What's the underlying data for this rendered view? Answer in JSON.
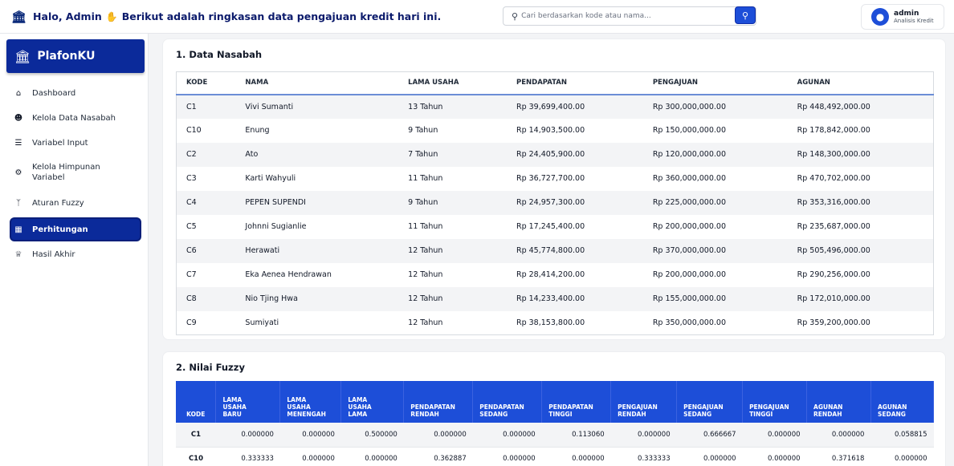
{
  "header": {
    "greeting_prefix": "Halo, Admin",
    "greeting_suffix": "Berikut adalah ringkasan data pengajuan kredit hari ini.",
    "search_placeholder": "Cari berdasarkan kode atau nama...",
    "user_name": "admin",
    "user_role": "Analisis Kredit"
  },
  "sidebar": {
    "brand": "PlafonKU",
    "items": [
      {
        "label": "Dashboard",
        "icon": "home-icon"
      },
      {
        "label": "Kelola Data Nasabah",
        "icon": "users-icon"
      },
      {
        "label": "Variabel Input",
        "icon": "list-icon"
      },
      {
        "label": "Kelola Himpunan Variabel",
        "icon": "gears-icon"
      },
      {
        "label": "Aturan Fuzzy",
        "icon": "branch-icon"
      },
      {
        "label": "Perhitungan",
        "icon": "calculator-icon",
        "active": true
      },
      {
        "label": "Hasil Akhir",
        "icon": "trophy-icon"
      }
    ]
  },
  "section1": {
    "title": "1. Data Nasabah",
    "columns": [
      "KODE",
      "NAMA",
      "LAMA USAHA",
      "PENDAPATAN",
      "PENGAJUAN",
      "AGUNAN"
    ],
    "rows": [
      [
        "C1",
        "Vivi Sumanti",
        "13 Tahun",
        "Rp 39,699,400.00",
        "Rp 300,000,000.00",
        "Rp 448,492,000.00"
      ],
      [
        "C10",
        "Enung",
        "9 Tahun",
        "Rp 14,903,500.00",
        "Rp 150,000,000.00",
        "Rp 178,842,000.00"
      ],
      [
        "C2",
        "Ato",
        "7 Tahun",
        "Rp 24,405,900.00",
        "Rp 120,000,000.00",
        "Rp 148,300,000.00"
      ],
      [
        "C3",
        "Karti Wahyuli",
        "11 Tahun",
        "Rp 36,727,700.00",
        "Rp 360,000,000.00",
        "Rp 470,702,000.00"
      ],
      [
        "C4",
        "PEPEN SUPENDI",
        "9 Tahun",
        "Rp 24,957,300.00",
        "Rp 225,000,000.00",
        "Rp 353,316,000.00"
      ],
      [
        "C5",
        "Johnni Sugianlie",
        "11 Tahun",
        "Rp 17,245,400.00",
        "Rp 200,000,000.00",
        "Rp 235,687,000.00"
      ],
      [
        "C6",
        "Herawati",
        "12 Tahun",
        "Rp 45,774,800.00",
        "Rp 370,000,000.00",
        "Rp 505,496,000.00"
      ],
      [
        "C7",
        "Eka Aenea Hendrawan",
        "12 Tahun",
        "Rp 28,414,200.00",
        "Rp 200,000,000.00",
        "Rp 290,256,000.00"
      ],
      [
        "C8",
        "Nio Tjing Hwa",
        "12 Tahun",
        "Rp 14,233,400.00",
        "Rp 155,000,000.00",
        "Rp 172,010,000.00"
      ],
      [
        "C9",
        "Sumiyati",
        "12 Tahun",
        "Rp 38,153,800.00",
        "Rp 350,000,000.00",
        "Rp 359,200,000.00"
      ]
    ]
  },
  "section2": {
    "title": "2. Nilai Fuzzy",
    "columns": [
      "KODE",
      "LAMA USAHA BARU",
      "LAMA USAHA MENENGAH",
      "LAMA USAHA LAMA",
      "PENDAPATAN RENDAH",
      "PENDAPATAN SEDANG",
      "PENDAPATAN TINGGI",
      "PENGAJUAN RENDAH",
      "PENGAJUAN SEDANG",
      "PENGAJUAN TINGGI",
      "AGUNAN RENDAH",
      "AGUNAN SEDANG"
    ],
    "rows": [
      [
        "C1",
        "0.000000",
        "0.000000",
        "0.500000",
        "0.000000",
        "0.000000",
        "0.113060",
        "0.000000",
        "0.666667",
        "0.000000",
        "0.000000",
        "0.058815"
      ],
      [
        "C10",
        "0.333333",
        "0.000000",
        "0.000000",
        "0.362887",
        "0.000000",
        "0.000000",
        "0.333333",
        "0.000000",
        "0.000000",
        "0.371618",
        "0.000000"
      ]
    ]
  },
  "colors": {
    "primary": "#0b2a9a",
    "accent": "#1d4ed8"
  }
}
